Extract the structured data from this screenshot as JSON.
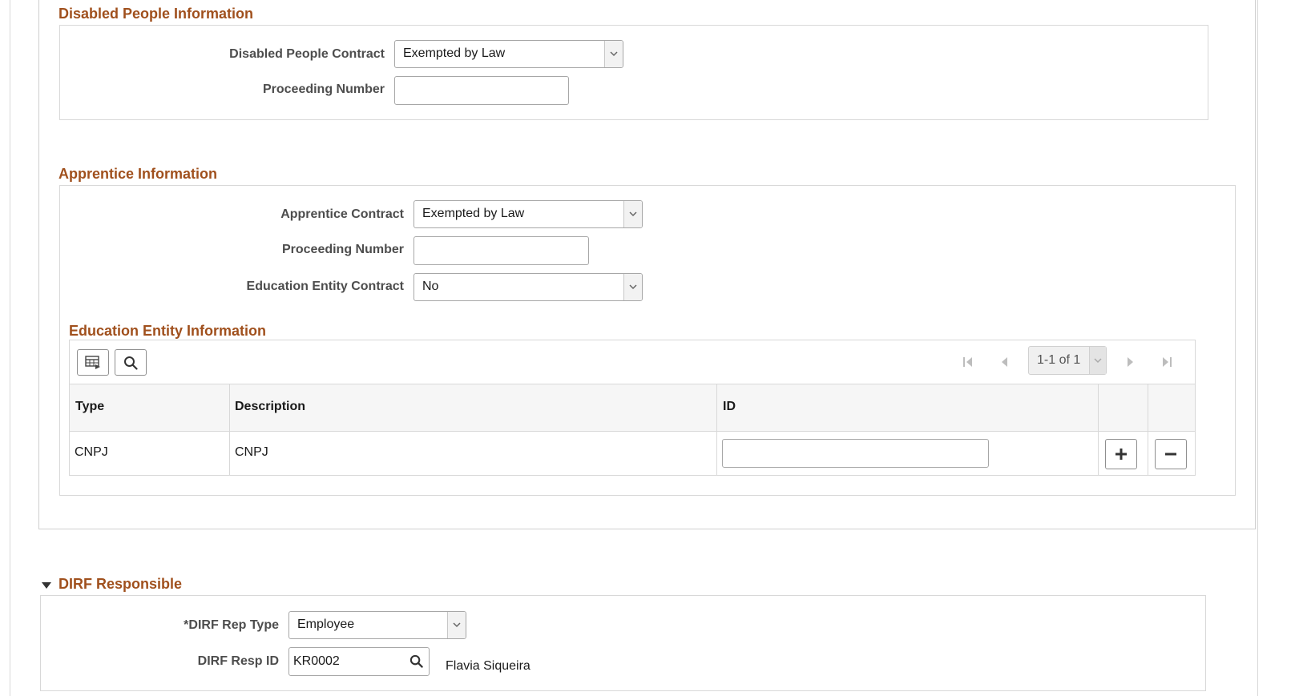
{
  "disabled_section": {
    "title": "Disabled People Information",
    "contract_label": "Disabled People Contract",
    "contract_value": "Exempted by Law",
    "proceeding_label": "Proceeding Number",
    "proceeding_value": ""
  },
  "apprentice_section": {
    "title": "Apprentice Information",
    "contract_label": "Apprentice Contract",
    "contract_value": "Exempted by Law",
    "proceeding_label": "Proceeding Number",
    "proceeding_value": "",
    "education_contract_label": "Education Entity Contract",
    "education_contract_value": "No"
  },
  "education_grid": {
    "title": "Education Entity Information",
    "pager_text": "1-1 of 1",
    "columns": [
      "Type",
      "Description",
      "ID"
    ],
    "rows": [
      {
        "type": "CNPJ",
        "description": "CNPJ",
        "id": ""
      }
    ]
  },
  "dirf_section": {
    "title": "DIRF Responsible",
    "rep_type_label": "*DIRF Rep Type",
    "rep_type_value": "Employee",
    "resp_id_label": "DIRF Resp ID",
    "resp_id_value": "KR0002",
    "resp_name": "Flavia Siqueira"
  },
  "icons": {
    "select_arrow": "chevron-down-icon",
    "grid_personalize": "grid-settings-icon",
    "grid_find": "search-icon",
    "first": "first-page-icon",
    "previous": "previous-page-icon",
    "next": "next-page-icon",
    "last": "last-page-icon",
    "add_row": "plus-icon",
    "delete_row": "minus-icon",
    "lookup": "search-icon",
    "collapse": "caret-down-icon"
  },
  "colors": {
    "section_title": "#a0501d",
    "label": "#4d4d4d",
    "border": "#d8d8d8"
  }
}
